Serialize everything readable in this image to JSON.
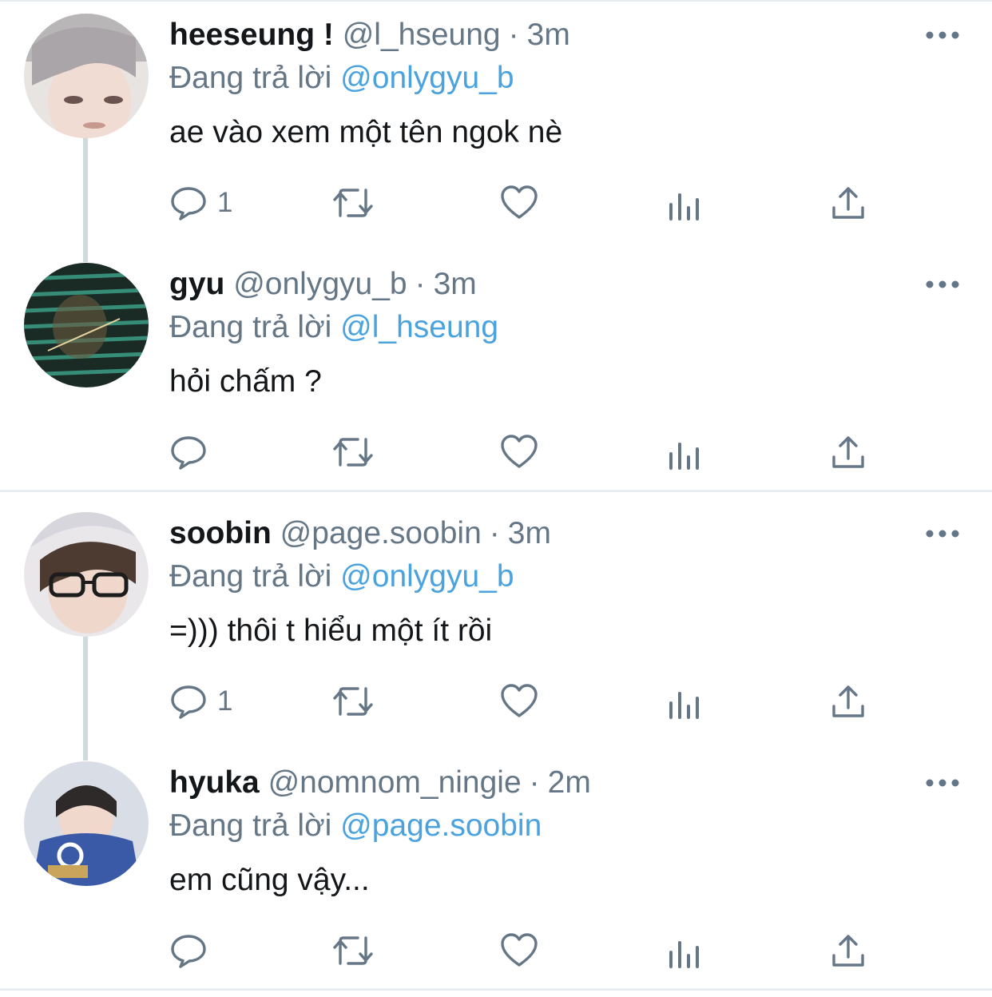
{
  "tweets": [
    {
      "name": "heeseung !",
      "handle": "@l_hseung",
      "separator": "·",
      "time": "3m",
      "reply_prefix": "Đang trả lời",
      "reply_to": "@onlygyu_b",
      "text": "ae vào xem một tên ngok nè",
      "reply_count": "1"
    },
    {
      "name": "gyu",
      "handle": "@onlygyu_b",
      "separator": "·",
      "time": "3m",
      "reply_prefix": "Đang trả lời",
      "reply_to": "@l_hseung",
      "text": "hỏi chấm ?",
      "reply_count": ""
    },
    {
      "name": "soobin",
      "handle": "@page.soobin",
      "separator": "·",
      "time": "3m",
      "reply_prefix": "Đang trả lời",
      "reply_to": "@onlygyu_b",
      "text": "=))) thôi t hiểu một ít rồi",
      "reply_count": "1"
    },
    {
      "name": "hyuka",
      "handle": "@nomnom_ningie",
      "separator": "·",
      "time": "2m",
      "reply_prefix": "Đang trả lời",
      "reply_to": "@page.soobin",
      "text": "em cũng vậy...",
      "reply_count": ""
    }
  ],
  "icons": {
    "reply": "reply-icon",
    "retweet": "retweet-icon",
    "like": "heart-icon",
    "analytics": "analytics-icon",
    "share": "share-icon",
    "more": "more-icon"
  },
  "colors": {
    "text": "#14171a",
    "muted": "#657786",
    "link": "#4aa3df",
    "divider": "#e6ecf0"
  }
}
